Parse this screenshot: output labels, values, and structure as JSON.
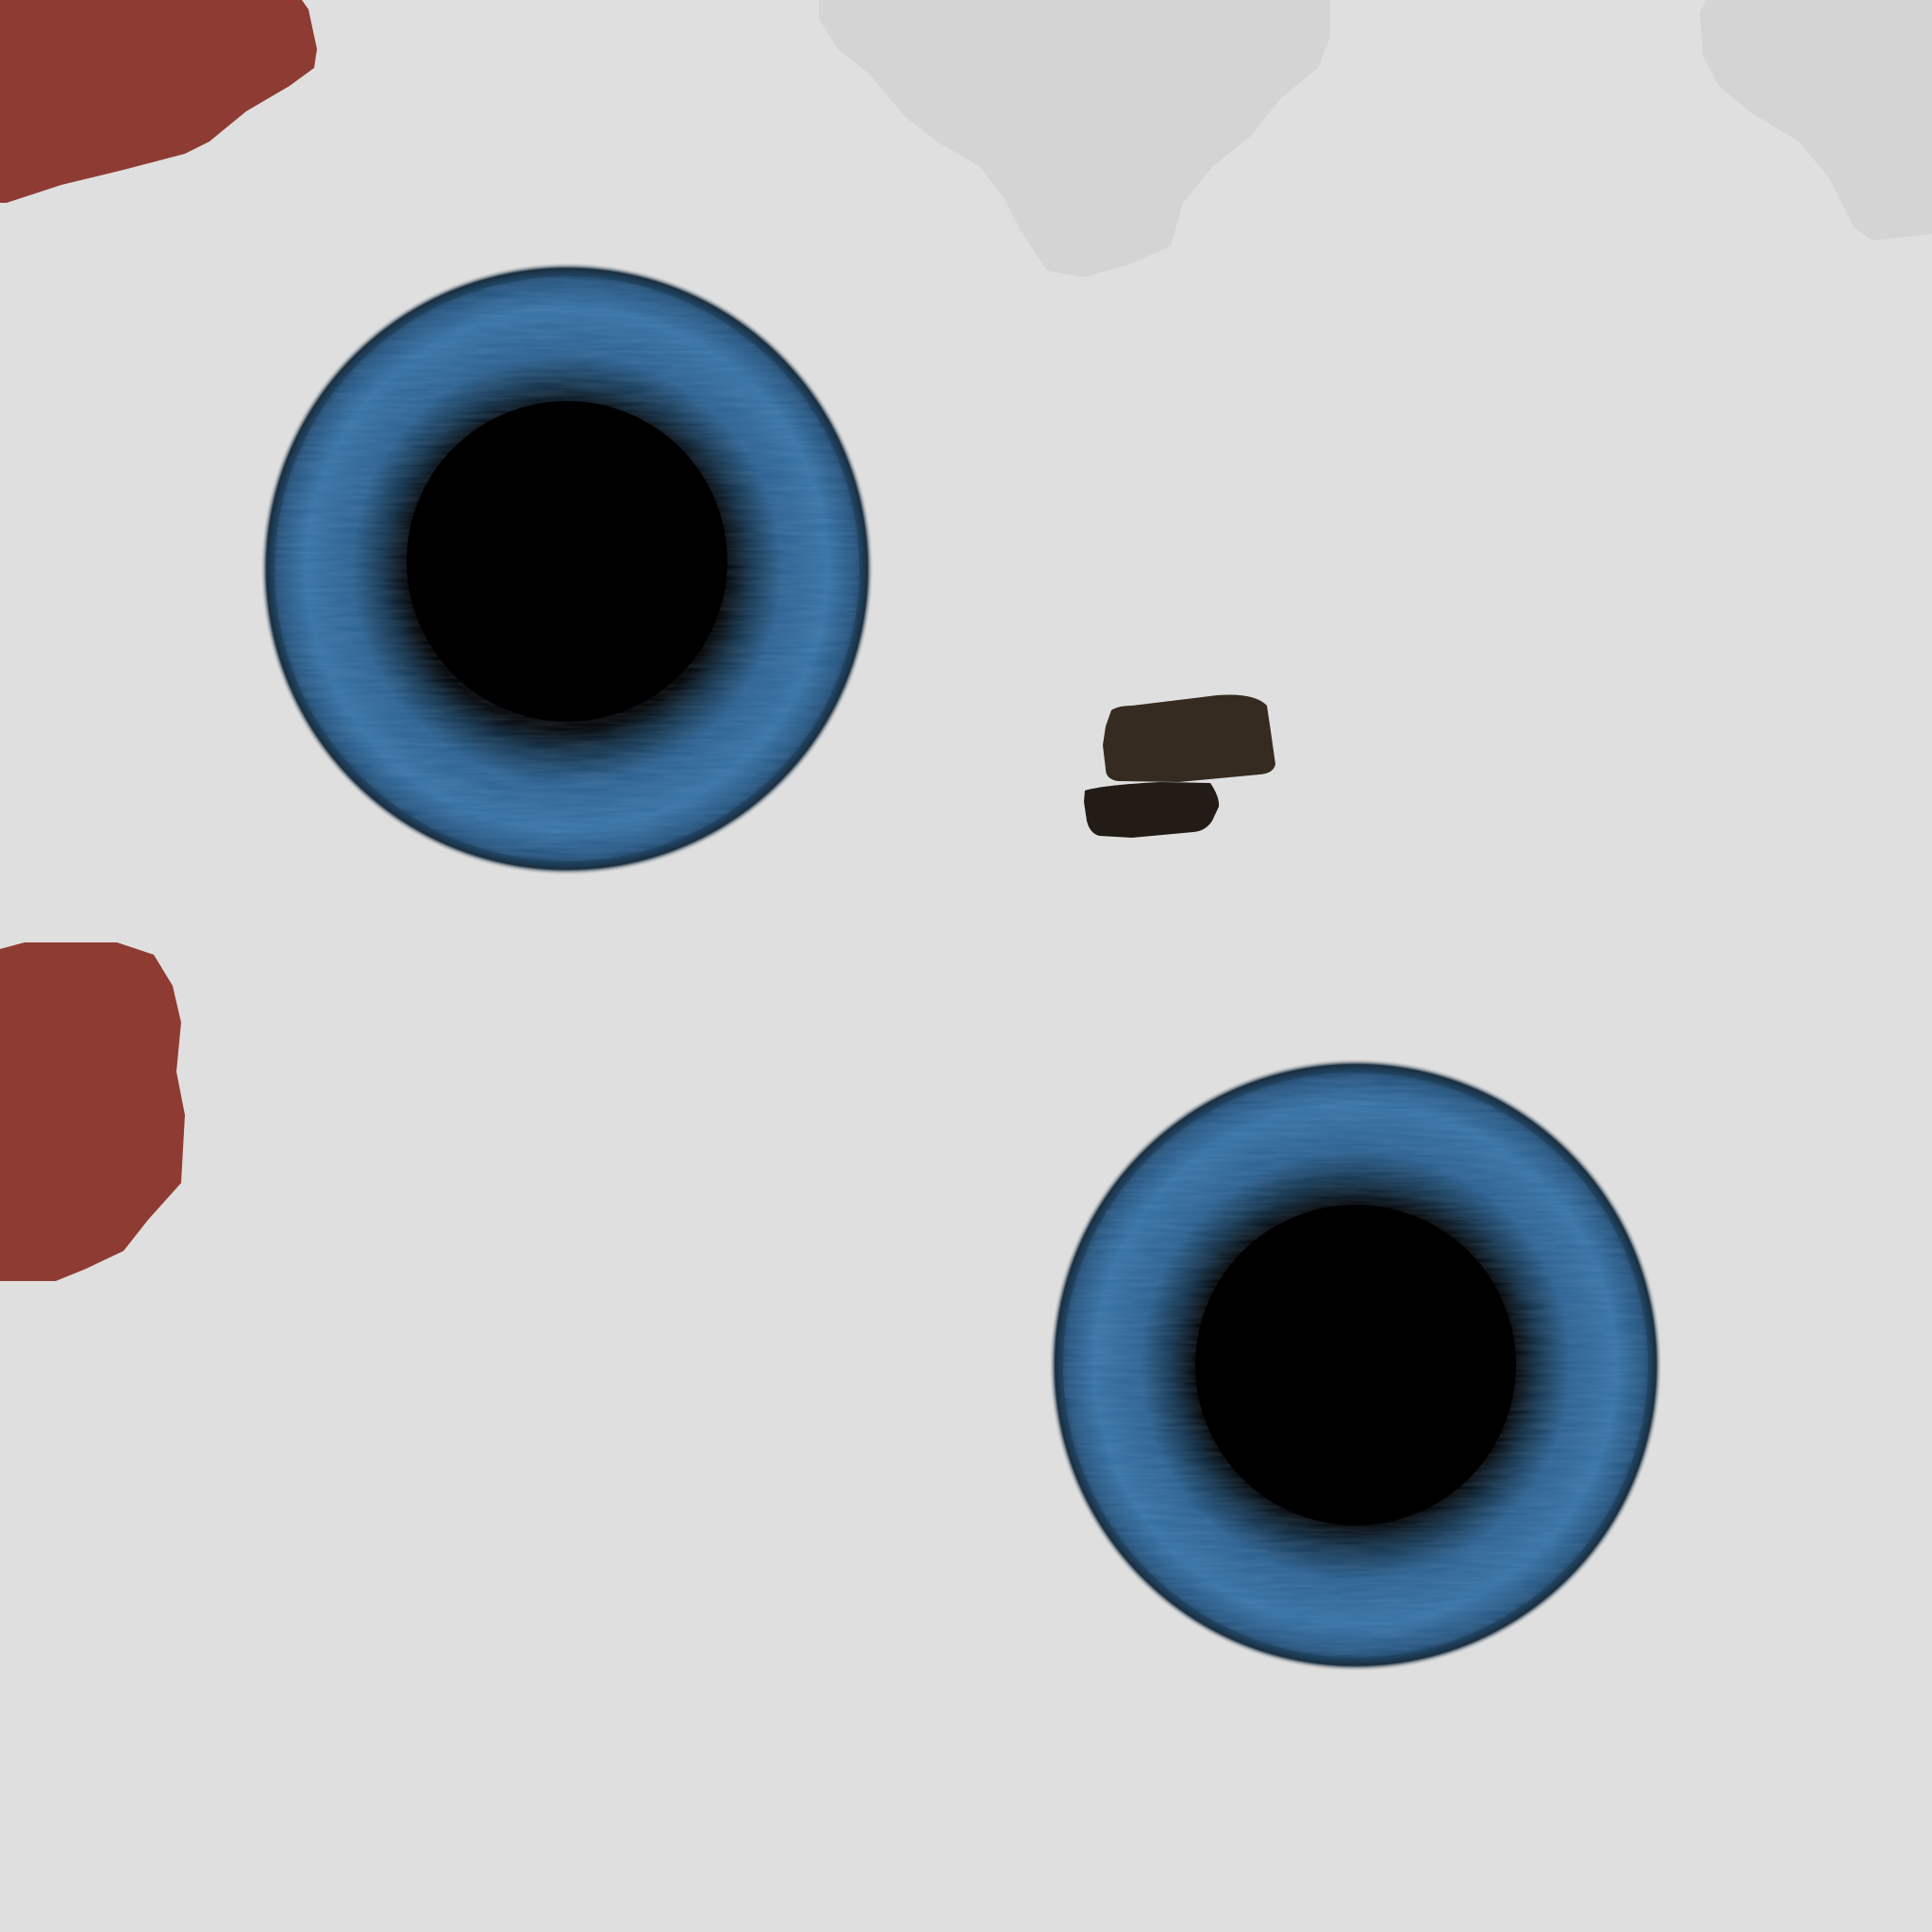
{
  "colors": {
    "background": "#dfdfdf",
    "red_patch": "#8e3c33",
    "grey_patch": "#d4d4d4",
    "iris": "#2f6a9c",
    "iris_dark": "#1a3a58",
    "pupil": "#000000",
    "blob_top": "#352b20",
    "blob_bottom": "#221b16"
  },
  "shapes": [
    "eye",
    "eye",
    "dark-blobs",
    "red-patches",
    "grey-patches"
  ]
}
